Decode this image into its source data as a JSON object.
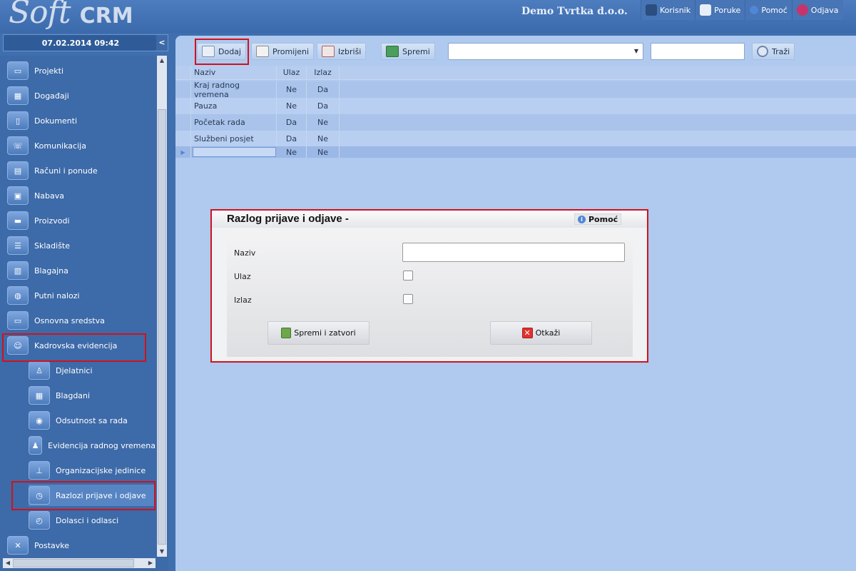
{
  "app": {
    "logo_script": "Soft",
    "logo_mark": "CRM",
    "company": "Demo Tvrtka d.o.o."
  },
  "topnav": [
    {
      "label": "Korisnik",
      "icon": "user-icon"
    },
    {
      "label": "Poruke",
      "icon": "envelope-icon"
    },
    {
      "label": "Pomoć",
      "icon": "info-icon"
    },
    {
      "label": "Odjava",
      "icon": "power-icon"
    }
  ],
  "sidebar": {
    "datetime": "07.02.2014 09:42",
    "collapse": "<",
    "items": [
      {
        "label": "Projekti"
      },
      {
        "label": "Događaji"
      },
      {
        "label": "Dokumenti"
      },
      {
        "label": "Komunikacija"
      },
      {
        "label": "Računi i ponude"
      },
      {
        "label": "Nabava"
      },
      {
        "label": "Proizvodi"
      },
      {
        "label": "Skladište"
      },
      {
        "label": "Blagajna"
      },
      {
        "label": "Putni nalozi"
      },
      {
        "label": "Osnovna sredstva"
      },
      {
        "label": "Kadrovska evidencija"
      }
    ],
    "subitems": [
      {
        "label": "Djelatnici"
      },
      {
        "label": "Blagdani"
      },
      {
        "label": "Odsutnost sa rada"
      },
      {
        "label": "Evidencija radnog vremena"
      },
      {
        "label": "Organizacijske jedinice"
      },
      {
        "label": "Razlozi prijave i odjave"
      },
      {
        "label": "Dolasci i odlasci"
      }
    ],
    "last": {
      "label": "Postavke"
    }
  },
  "toolbar": {
    "add": "Dodaj",
    "edit": "Promijeni",
    "delete": "Izbriši",
    "save": "Spremi",
    "filter_value": "",
    "search_value": "",
    "search": "Traži"
  },
  "grid": {
    "columns": [
      "Naziv",
      "Ulaz",
      "Izlaz"
    ],
    "rows": [
      [
        "Kraj radnog vremena",
        "Ne",
        "Da"
      ],
      [
        "Pauza",
        "Ne",
        "Da"
      ],
      [
        "Početak rada",
        "Da",
        "Ne"
      ],
      [
        "Službeni posjet",
        "Da",
        "Ne"
      ]
    ],
    "new_row": [
      "",
      "Ne",
      "Ne"
    ]
  },
  "dialog": {
    "title": "Razlog prijave i odjave -",
    "help": "Pomoć",
    "fields": {
      "naziv_label": "Naziv",
      "naziv_value": "",
      "ulaz_label": "Ulaz",
      "ulaz_checked": false,
      "izlaz_label": "Izlaz",
      "izlaz_checked": false
    },
    "save_close": "Spremi i zatvori",
    "cancel": "Otkaži"
  }
}
